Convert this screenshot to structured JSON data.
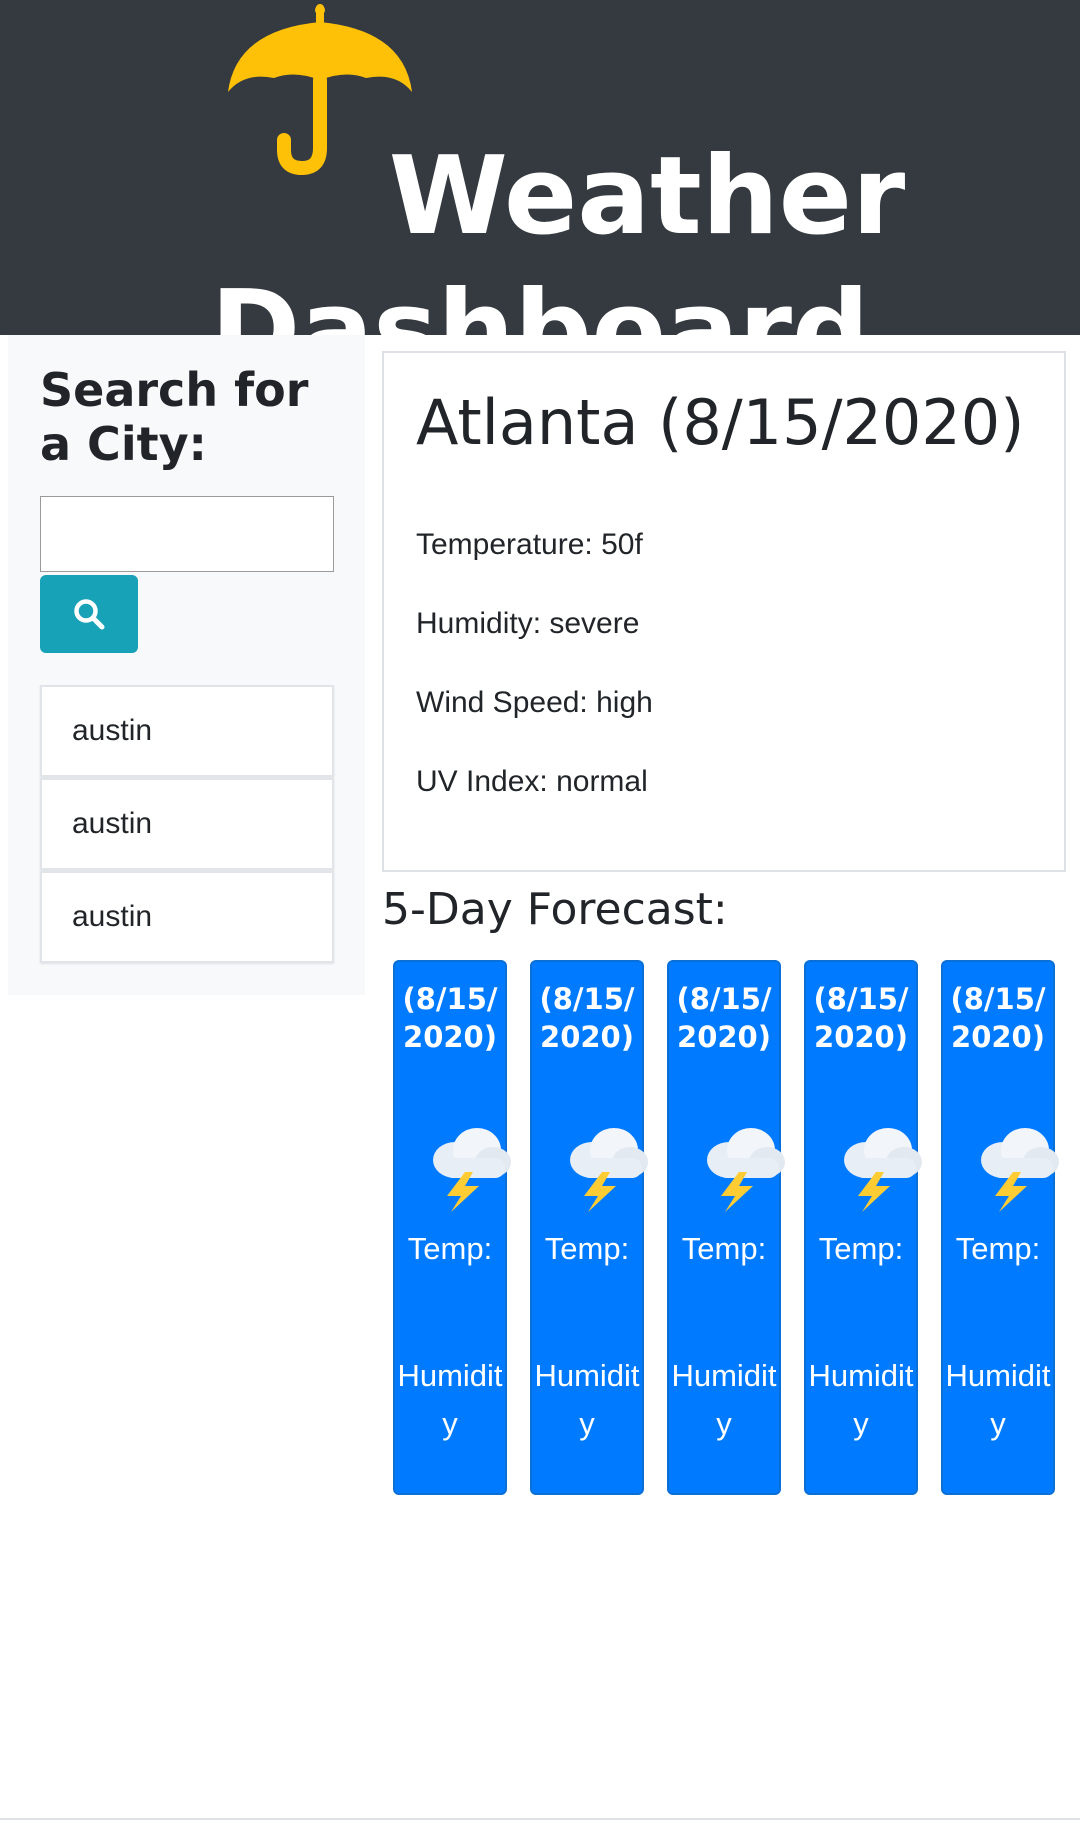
{
  "header": {
    "title_line1": "Weather",
    "title_line2": "Dashboard",
    "logo_icon": "umbrella-icon",
    "logo_color": "#ffc107",
    "background": "#343a40"
  },
  "sidebar": {
    "heading": "Search for a City:",
    "search_input_value": "",
    "search_button_icon": "search-icon",
    "search_button_color": "#17a2b8",
    "history": [
      "austin",
      "austin",
      "austin"
    ]
  },
  "current": {
    "heading": "Atlanta (8/15/2020)",
    "temperature": "Temperature: 50f",
    "humidity": "Humidity: severe",
    "wind_speed": "Wind Speed: high",
    "uv_index": "UV Index: normal"
  },
  "forecast": {
    "heading": "5-Day Forecast:",
    "card_color": "#007bff",
    "days": [
      {
        "date": "(8/15/2020)",
        "icon": "thunder-cloud-icon",
        "temp": "Temp:",
        "humidity": "Humidity"
      },
      {
        "date": "(8/15/2020)",
        "icon": "thunder-cloud-icon",
        "temp": "Temp:",
        "humidity": "Humidity"
      },
      {
        "date": "(8/15/2020)",
        "icon": "thunder-cloud-icon",
        "temp": "Temp:",
        "humidity": "Humidity"
      },
      {
        "date": "(8/15/2020)",
        "icon": "thunder-cloud-icon",
        "temp": "Temp:",
        "humidity": "Humidity"
      },
      {
        "date": "(8/15/2020)",
        "icon": "thunder-cloud-icon",
        "temp": "Temp:",
        "humidity": "Humidity"
      }
    ]
  }
}
